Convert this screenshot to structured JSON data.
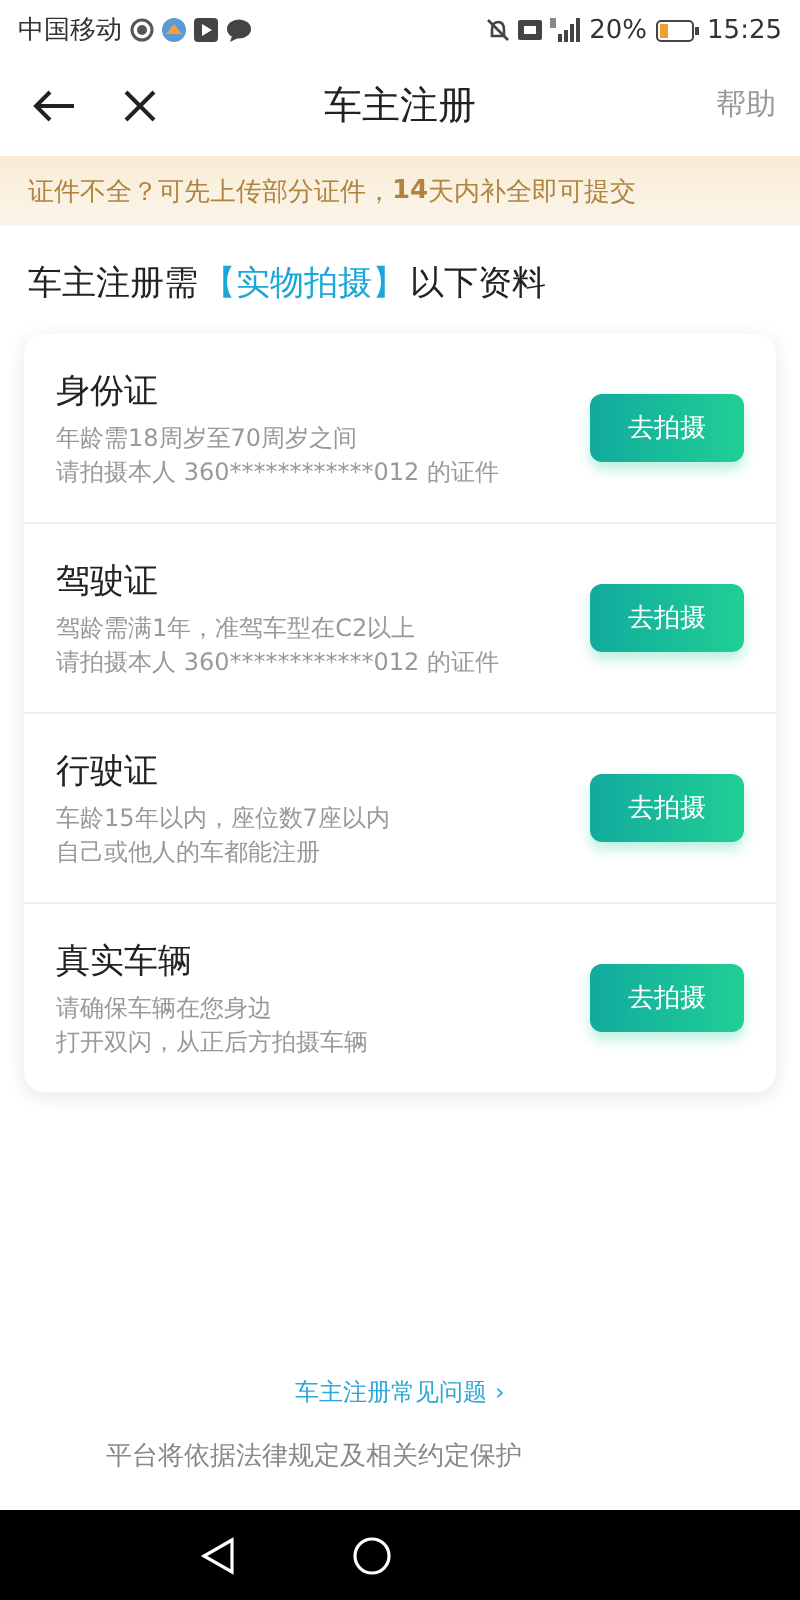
{
  "status_bar": {
    "carrier": "中国移动",
    "battery": "20%",
    "time": "15:25"
  },
  "header": {
    "title": "车主注册",
    "help": "帮助"
  },
  "notice": "证件不全？可先上传部分证件，**14**天内补全即可提交",
  "heading": {
    "before": "车主注册需",
    "highlight": "【实物拍摄】",
    "after": "以下资料"
  },
  "items": [
    {
      "title": "身份证",
      "lines": [
        "年龄需18周岁至70周岁之间",
        "请拍摄本人 360************012 的证件"
      ],
      "button": "去拍摄"
    },
    {
      "title": "驾驶证",
      "lines": [
        "驾龄需满1年，准驾车型在C2以上",
        "请拍摄本人 360************012 的证件"
      ],
      "button": "去拍摄"
    },
    {
      "title": "行驶证",
      "lines": [
        "车龄15年以内，座位数7座以内",
        "自己或他人的车都能注册"
      ],
      "button": "去拍摄"
    },
    {
      "title": "真实车辆",
      "lines": [
        "请确保车辆在您身边",
        "打开双闪，从正后方拍摄车辆"
      ],
      "button": "去拍摄"
    }
  ],
  "faq_link": "车主注册常见问题 ›",
  "footer": "平台将依据法律规定及相关约定保护"
}
